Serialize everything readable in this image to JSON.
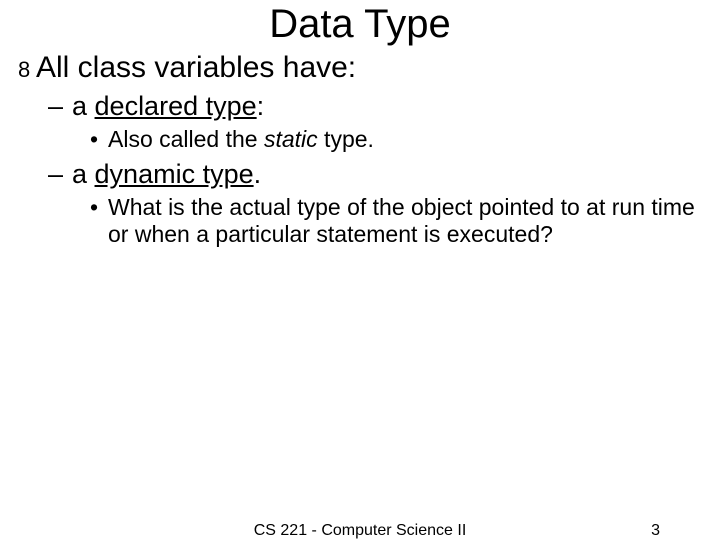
{
  "title": "Data Type",
  "l1_text": "All class variables have:",
  "l2a_prefix": "a ",
  "l2a_underlined": "declared type",
  "l2a_suffix": ":",
  "l3a_prefix": "Also called the ",
  "l3a_italic": "static",
  "l3a_suffix": " type.",
  "l2b_prefix": "a ",
  "l2b_underlined": "dynamic type",
  "l2b_suffix": ".",
  "l3b_text": "What is the actual type of the object pointed to at run time or when a particular statement is executed?",
  "footer_center": "CS 221 - Computer Science II",
  "footer_page": "3"
}
